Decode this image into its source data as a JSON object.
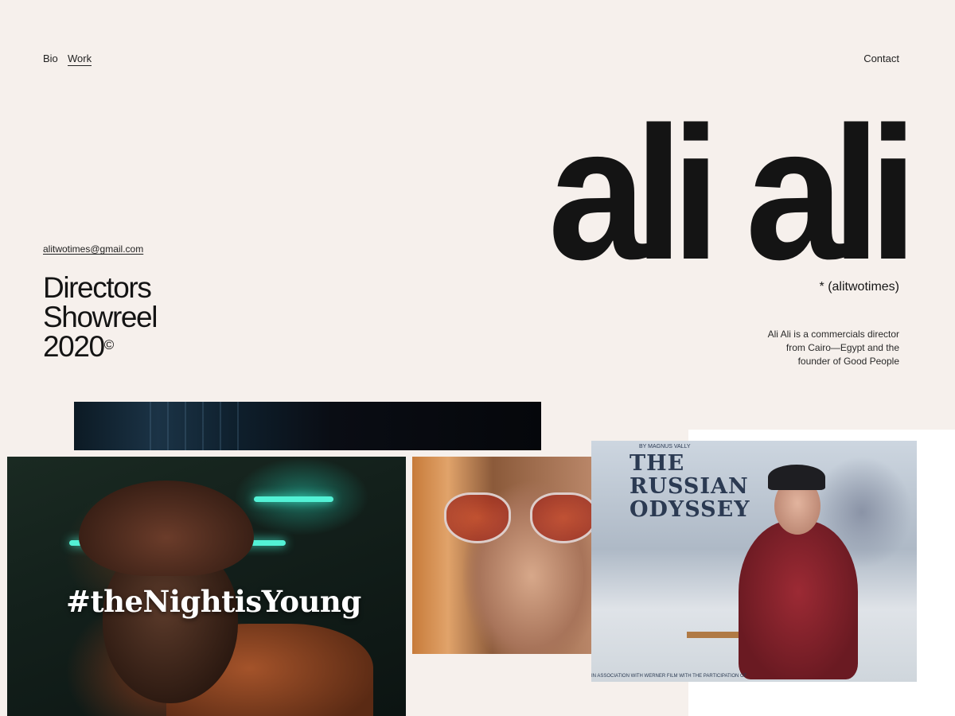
{
  "nav": {
    "bio": "Bio",
    "work": "Work",
    "contact": "Contact"
  },
  "brand": {
    "name": "ali ali",
    "handle": "* (alitwotimes)",
    "bio_line1": "Ali Ali is a commercials director",
    "bio_line2": "from Cairo—Egypt and the",
    "bio_line3": "founder of Good People"
  },
  "contact": {
    "email": "alitwotimes@gmail.com"
  },
  "showreel": {
    "line1": "Directors",
    "line2": "Showreel",
    "line3": "2020",
    "mark": "©"
  },
  "media": {
    "night_caption": "#theNightisYoung",
    "poster_top": "BY MAGNUS VALLY",
    "poster_line1": "THE",
    "poster_line2": "RUSSIAN",
    "poster_line3": "ODYSSEY",
    "poster_credit": "IN ASSOCIATION WITH WERNER FILM WITH THE PARTICIPATION OF"
  },
  "colors": {
    "background": "#f6f0ec",
    "text": "#141414",
    "accent_neon": "#53f2d6"
  }
}
